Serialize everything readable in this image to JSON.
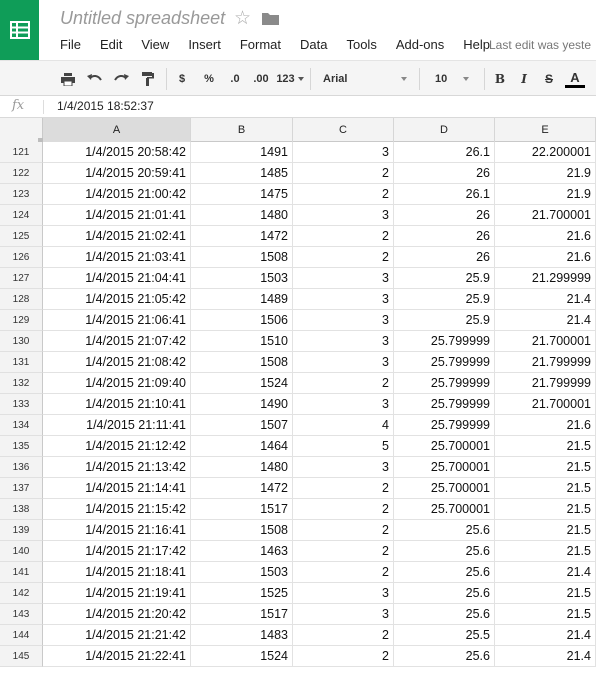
{
  "app": {
    "title": "Untitled spreadsheet",
    "last_edit": "Last edit was yeste",
    "menu": [
      "File",
      "Edit",
      "View",
      "Insert",
      "Format",
      "Data",
      "Tools",
      "Add-ons",
      "Help"
    ]
  },
  "toolbar": {
    "currency": "$",
    "percent": "%",
    "dec_decrease": ".0",
    "dec_increase": ".00",
    "more_formats": "123",
    "font": "Arial",
    "font_size": "10",
    "bold": "B",
    "italic": "I",
    "strike": "S",
    "text_color": "A"
  },
  "formula_bar": {
    "fx_label": "fx",
    "value": "1/4/2015 18:52:37"
  },
  "columns": [
    "A",
    "B",
    "C",
    "D",
    "E"
  ],
  "rows": [
    {
      "n": "121",
      "a": "1/4/2015 20:58:42",
      "b": "1491",
      "c": "3",
      "d": "26.1",
      "e": "22.200001"
    },
    {
      "n": "122",
      "a": "1/4/2015 20:59:41",
      "b": "1485",
      "c": "2",
      "d": "26",
      "e": "21.9"
    },
    {
      "n": "123",
      "a": "1/4/2015 21:00:42",
      "b": "1475",
      "c": "2",
      "d": "26.1",
      "e": "21.9"
    },
    {
      "n": "124",
      "a": "1/4/2015 21:01:41",
      "b": "1480",
      "c": "3",
      "d": "26",
      "e": "21.700001"
    },
    {
      "n": "125",
      "a": "1/4/2015 21:02:41",
      "b": "1472",
      "c": "2",
      "d": "26",
      "e": "21.6"
    },
    {
      "n": "126",
      "a": "1/4/2015 21:03:41",
      "b": "1508",
      "c": "2",
      "d": "26",
      "e": "21.6"
    },
    {
      "n": "127",
      "a": "1/4/2015 21:04:41",
      "b": "1503",
      "c": "3",
      "d": "25.9",
      "e": "21.299999"
    },
    {
      "n": "128",
      "a": "1/4/2015 21:05:42",
      "b": "1489",
      "c": "3",
      "d": "25.9",
      "e": "21.4"
    },
    {
      "n": "129",
      "a": "1/4/2015 21:06:41",
      "b": "1506",
      "c": "3",
      "d": "25.9",
      "e": "21.4"
    },
    {
      "n": "130",
      "a": "1/4/2015 21:07:42",
      "b": "1510",
      "c": "3",
      "d": "25.799999",
      "e": "21.700001"
    },
    {
      "n": "131",
      "a": "1/4/2015 21:08:42",
      "b": "1508",
      "c": "3",
      "d": "25.799999",
      "e": "21.799999"
    },
    {
      "n": "132",
      "a": "1/4/2015 21:09:40",
      "b": "1524",
      "c": "2",
      "d": "25.799999",
      "e": "21.799999"
    },
    {
      "n": "133",
      "a": "1/4/2015 21:10:41",
      "b": "1490",
      "c": "3",
      "d": "25.799999",
      "e": "21.700001"
    },
    {
      "n": "134",
      "a": "1/4/2015 21:11:41",
      "b": "1507",
      "c": "4",
      "d": "25.799999",
      "e": "21.6"
    },
    {
      "n": "135",
      "a": "1/4/2015 21:12:42",
      "b": "1464",
      "c": "5",
      "d": "25.700001",
      "e": "21.5"
    },
    {
      "n": "136",
      "a": "1/4/2015 21:13:42",
      "b": "1480",
      "c": "3",
      "d": "25.700001",
      "e": "21.5"
    },
    {
      "n": "137",
      "a": "1/4/2015 21:14:41",
      "b": "1472",
      "c": "2",
      "d": "25.700001",
      "e": "21.5"
    },
    {
      "n": "138",
      "a": "1/4/2015 21:15:42",
      "b": "1517",
      "c": "2",
      "d": "25.700001",
      "e": "21.5"
    },
    {
      "n": "139",
      "a": "1/4/2015 21:16:41",
      "b": "1508",
      "c": "2",
      "d": "25.6",
      "e": "21.5"
    },
    {
      "n": "140",
      "a": "1/4/2015 21:17:42",
      "b": "1463",
      "c": "2",
      "d": "25.6",
      "e": "21.5"
    },
    {
      "n": "141",
      "a": "1/4/2015 21:18:41",
      "b": "1503",
      "c": "2",
      "d": "25.6",
      "e": "21.4"
    },
    {
      "n": "142",
      "a": "1/4/2015 21:19:41",
      "b": "1525",
      "c": "3",
      "d": "25.6",
      "e": "21.5"
    },
    {
      "n": "143",
      "a": "1/4/2015 21:20:42",
      "b": "1517",
      "c": "3",
      "d": "25.6",
      "e": "21.5"
    },
    {
      "n": "144",
      "a": "1/4/2015 21:21:42",
      "b": "1483",
      "c": "2",
      "d": "25.5",
      "e": "21.4"
    },
    {
      "n": "145",
      "a": "1/4/2015 21:22:41",
      "b": "1524",
      "c": "2",
      "d": "25.6",
      "e": "21.4"
    }
  ]
}
